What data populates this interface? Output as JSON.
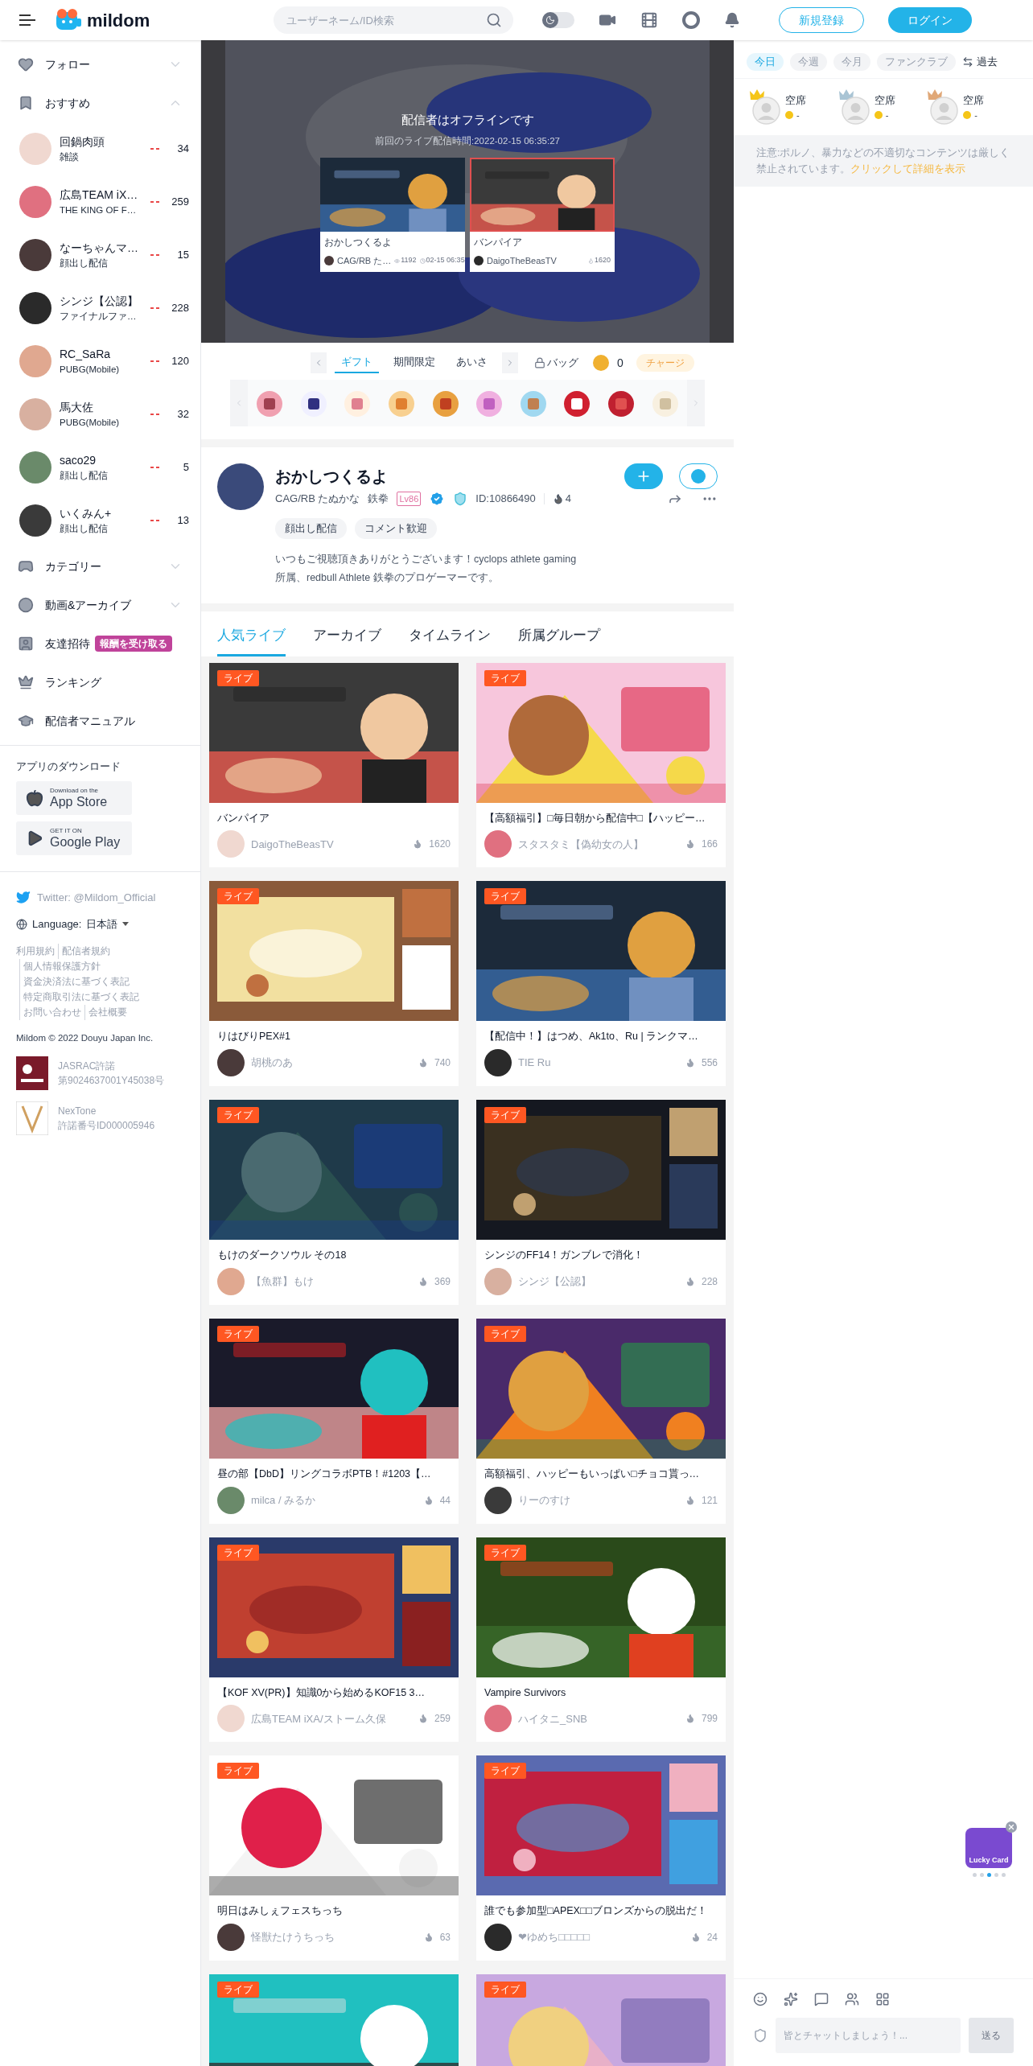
{
  "header": {
    "logo": "mildom",
    "search": {
      "placeholder": "ユーザーネーム/ID検索"
    },
    "dark_mode": false,
    "signup": "新規登録",
    "login": "ログイン"
  },
  "sidebar": {
    "items": [
      {
        "kind": "section",
        "label": "フォロー",
        "expanded": false
      },
      {
        "kind": "section",
        "label": "おすすめ",
        "expanded": true
      },
      {
        "kind": "channel",
        "name": "回鍋肉頭",
        "sub": "雑談",
        "viewers": "34"
      },
      {
        "kind": "channel",
        "name": "広島TEAM iX…",
        "sub": "THE KING OF F…",
        "viewers": "259"
      },
      {
        "kind": "channel",
        "name": "なーちゃんマ…",
        "sub": "顔出し配信",
        "viewers": "15"
      },
      {
        "kind": "channel",
        "name": "シンジ【公認】",
        "sub": "ファイナルファ…",
        "viewers": "228"
      },
      {
        "kind": "channel",
        "name": "RC_SaRa",
        "sub": "PUBG(Mobile)",
        "viewers": "120"
      },
      {
        "kind": "channel",
        "name": "馬大佐",
        "sub": "PUBG(Mobile)",
        "viewers": "32"
      },
      {
        "kind": "channel",
        "name": "saco29",
        "sub": "顔出し配信",
        "viewers": "5"
      },
      {
        "kind": "channel",
        "name": "いくみん+",
        "sub": "顔出し配信",
        "viewers": "13"
      },
      {
        "kind": "section",
        "label": "カテゴリー",
        "expanded": false
      },
      {
        "kind": "section",
        "label": "動画&アーカイブ",
        "expanded": false
      },
      {
        "kind": "link",
        "label": "友達招待",
        "badge": "報酬を受け取る"
      },
      {
        "kind": "link",
        "label": "ランキング"
      },
      {
        "kind": "link",
        "label": "配信者マニュアル"
      }
    ],
    "app_download": {
      "title": "アプリのダウンロード",
      "stores": [
        {
          "small": "Download on the",
          "big": "App Store"
        },
        {
          "small": "GET IT ON",
          "big": "Google Play"
        }
      ]
    },
    "twitter": "Twitter: @Mildom_Official",
    "language": {
      "label": "Language:",
      "value": "日本語"
    },
    "footer_links": [
      "利用規約",
      "配信者規約",
      "個人情報保護方針",
      "資金決済法に基づく表記",
      "特定商取引法に基づく表記",
      "お問い合わせ",
      "会社概要"
    ],
    "copyright": "Mildom © 2022 Douyu Japan Inc.",
    "licenses": [
      {
        "name": "JASRAC許諾",
        "number": "第9024637001Y45038号"
      },
      {
        "name": "NexTone",
        "number": "許諾番号ID000005946"
      }
    ]
  },
  "player": {
    "offline_title": "配信者はオフラインです",
    "last_live": "前回のライブ配信時間:2022-02-15 06:35:27",
    "recommend": [
      {
        "title": "おかしつくるよ",
        "streamer": "CAG/RB た…",
        "stats": [
          {
            "kind": "views",
            "text": "1192"
          },
          {
            "kind": "time",
            "text": "02-15 06:35"
          }
        ]
      },
      {
        "title": "バンパイア",
        "streamer": "DaigoTheBeasTV",
        "stats": [
          {
            "kind": "heat",
            "text": "1620"
          }
        ]
      }
    ]
  },
  "gift_bar": {
    "tabs": [
      {
        "label": "ギフト",
        "selected": true
      },
      {
        "label": "期間限定",
        "selected": false
      },
      {
        "label": "あいさ",
        "selected": false
      }
    ],
    "bag": "バッグ",
    "coins": "0",
    "charge": "チャージ"
  },
  "profile": {
    "name": "おかしつくるよ",
    "team": "CAG/RB たぬかな",
    "game": "鉄拳",
    "level": "Lv86",
    "verified": true,
    "id": "ID:10866490",
    "fans": "4",
    "tags": [
      "顔出し配信",
      "コメント歓迎"
    ],
    "bio": "いつもご視聴頂きありがとうございます！cyclops athlete gaming所属、redbull Athlete 鉄拳のプロゲーマーです。"
  },
  "content_tabs": [
    {
      "label": "人気ライブ",
      "selected": true
    },
    {
      "label": "アーカイブ",
      "selected": false
    },
    {
      "label": "タイムライン",
      "selected": false
    },
    {
      "label": "所属グループ",
      "selected": false
    }
  ],
  "cards": [
    {
      "badge": "ライブ",
      "title": "バンパイア",
      "streamer": "DaigoTheBeasTV",
      "heat": "1620"
    },
    {
      "badge": "ライブ",
      "title": "【高額福引】□毎日朝から配信中□【ハッピー…",
      "streamer": "スタスタミ【偽幼女の人】",
      "heat": "166"
    },
    {
      "badge": "ライブ",
      "title": "りはびりPEX#1",
      "streamer": "胡桃のあ",
      "heat": "740"
    },
    {
      "badge": "ライブ",
      "title": "【配信中！】はつめ、Ak1to、Ru | ランクマ…",
      "streamer": "TIE Ru",
      "heat": "556"
    },
    {
      "badge": "ライブ",
      "title": "もけのダークソウル その18",
      "streamer": "【魚群】もけ",
      "heat": "369"
    },
    {
      "badge": "ライブ",
      "title": "シンジのFF14！ガンブレで消化！",
      "streamer": "シンジ【公認】",
      "heat": "228"
    },
    {
      "badge": "ライブ",
      "title": "昼の部【DbD】リングコラボPTB！#1203【…",
      "streamer": "milca / みるか",
      "heat": "44"
    },
    {
      "badge": "ライブ",
      "title": "高額福引、ハッピーもいっぱい□チョコ貰っ…",
      "streamer": "りーのすけ",
      "heat": "121"
    },
    {
      "badge": "ライブ",
      "title": "【KOF XV(PR)】知識0から始めるKOF15 3…",
      "streamer": "広島TEAM iXA/ストーム久保",
      "heat": "259"
    },
    {
      "badge": "ライブ",
      "title": "Vampire Survivors",
      "streamer": "ハイタニ_SNB",
      "heat": "799"
    },
    {
      "badge": "ライブ",
      "title": "明日はみしぇフェスちっち",
      "streamer": "怪獣たけうちっち",
      "heat": "63"
    },
    {
      "badge": "ライブ",
      "title": "誰でも参加型□APEX□□ブロンズからの脱出だ！",
      "streamer": "❤ゆめち□□□□□",
      "heat": "24"
    },
    {
      "badge": "ライブ"
    },
    {
      "badge": "ライブ"
    }
  ],
  "ranking": {
    "tabs": [
      {
        "label": "今日",
        "selected": true
      },
      {
        "label": "今週",
        "selected": false
      },
      {
        "label": "今月",
        "selected": false
      },
      {
        "label": "ファンクラブ",
        "selected": false
      }
    ],
    "past": "過去",
    "seats": [
      {
        "name": "空席",
        "coins": "-",
        "color": "#f5c518"
      },
      {
        "name": "空席",
        "coins": "-",
        "color": "#a9c4d4"
      },
      {
        "name": "空席",
        "coins": "-",
        "color": "#e0a878"
      }
    ],
    "notice": "注意:ポルノ、暴力などの不適切なコンテンツは厳しく禁止されています。",
    "notice_link": "クリックして詳細を表示"
  },
  "lucky_card": {
    "label": "Lucky Card",
    "pages": [
      {
        "selected": false
      },
      {
        "selected": false
      },
      {
        "selected": true
      },
      {
        "selected": false
      },
      {
        "selected": false
      }
    ]
  },
  "chat": {
    "placeholder": "皆とチャットしましょう！...",
    "send": "送る",
    "send_disabled": true
  }
}
